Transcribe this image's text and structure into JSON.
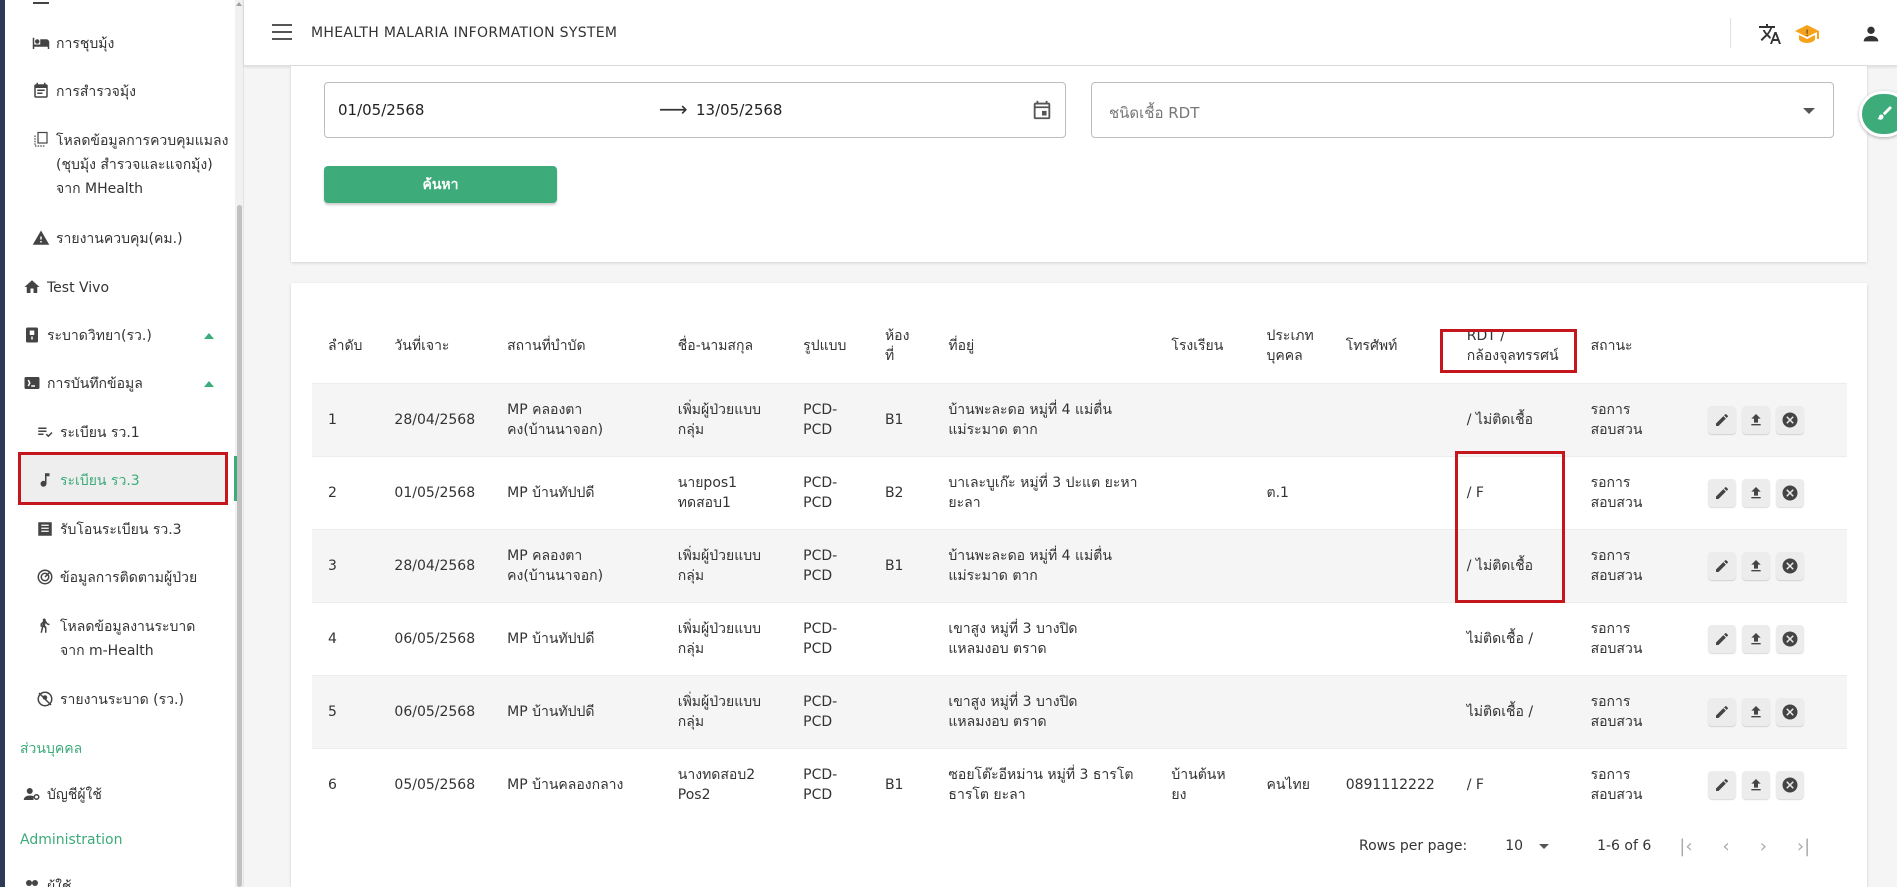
{
  "app": {
    "title": "MHEALTH MALARIA INFORMATION SYSTEM"
  },
  "colors": {
    "accent": "#3dab7a",
    "highlight_border": "#c4161c",
    "sidebar_strip": "#2e3a55"
  },
  "sidebar": {
    "items": [
      {
        "label": "การชุบมุ้ง",
        "icon": "bed-icon"
      },
      {
        "label": "การสำรวจมุ้ง",
        "icon": "event-note-icon"
      },
      {
        "label": "โหลดข้อมูลการควบคุมแมลง (ชุบมุ้ง สำรวจและแจกมุ้ง) จาก MHealth",
        "icon": "library-books-icon"
      },
      {
        "label": "รายงานควบคุม(คม.)",
        "icon": "warning-icon"
      },
      {
        "label": "Test Vivo",
        "icon": "home-icon"
      },
      {
        "label": "ระบาดวิทยา(รว.)",
        "icon": "ballot-icon"
      },
      {
        "label": "การบันทึกข้อมูล",
        "icon": "video-label-icon"
      },
      {
        "label": "ระเบียน รว.1",
        "icon": "playlist-edit-icon"
      },
      {
        "label": "ระเบียน รว.3",
        "icon": "music-note-icon"
      },
      {
        "label": "รับโอนระเบียน รว.3",
        "icon": "list-alt-icon"
      },
      {
        "label": "ข้อมูลการติดตามผู้ป่วย",
        "icon": "track-changes-icon"
      },
      {
        "label": "โหลดข้อมูลงานระบาดจาก m-Health",
        "icon": "person-walking-icon"
      },
      {
        "label": "รายงานระบาด (รว.)",
        "icon": "no-accounts-icon"
      },
      {
        "label": "บัญชีผู้ใช้",
        "icon": "user-cog-icon"
      },
      {
        "label": "ผู้ใช้",
        "icon": "people-icon"
      }
    ],
    "sections": {
      "personal": "ส่วนบุคคล",
      "admin": "Administration"
    }
  },
  "filter": {
    "date_from": "01/05/2568",
    "date_to": "13/05/2568",
    "rdt_placeholder": "ชนิดเชื้อ RDT",
    "search_label": "ค้นหา"
  },
  "table": {
    "headers": {
      "no": "ลำดับ",
      "date": "วันที่เจาะ",
      "place": "สถานที่บำบัด",
      "name": "ชื่อ-นามสกุล",
      "form": "รูปแบบ",
      "room_1": "ห้อง",
      "room_2": "ที่",
      "address": "ที่อยู่",
      "school": "โรงเรียน",
      "ptype_1": "ประเภท",
      "ptype_2": "บุคคล",
      "phone": "โทรศัพท์",
      "rdt_1": "RDT /",
      "rdt_2": "กล้องจุลทรรศน์",
      "status": "สถานะ"
    },
    "rows": [
      {
        "no": "1",
        "date": "28/04/2568",
        "place": "MP คลองตาคง(บ้านนาจอก)",
        "name": "เพิ่มผู้ป่วยแบบกลุ่ม",
        "form": "PCD-PCD",
        "room": "B1",
        "address": "บ้านพะละดอ หมู่ที่ 4 แม่ตื่น แม่ระมาด ตาก",
        "school": "",
        "ptype": "",
        "phone": "",
        "rdt": "/ ไม่ติดเชื้อ",
        "status": "รอการสอบสวน"
      },
      {
        "no": "2",
        "date": "01/05/2568",
        "place": "MP บ้านทัปปดี",
        "name": "นายpos1 ทดสอบ1",
        "form": "PCD-PCD",
        "room": "B2",
        "address": "บาเละบูเก๊ะ หมู่ที่ 3 ปะแต ยะหา ยะลา",
        "school": "",
        "ptype": "ต.1",
        "phone": "",
        "rdt": "/ F",
        "status": "รอการสอบสวน"
      },
      {
        "no": "3",
        "date": "28/04/2568",
        "place": "MP คลองตาคง(บ้านนาจอก)",
        "name": "เพิ่มผู้ป่วยแบบกลุ่ม",
        "form": "PCD-PCD",
        "room": "B1",
        "address": "บ้านพะละดอ หมู่ที่ 4 แม่ตื่น แม่ระมาด ตาก",
        "school": "",
        "ptype": "",
        "phone": "",
        "rdt": "/ ไม่ติดเชื้อ",
        "status": "รอการสอบสวน"
      },
      {
        "no": "4",
        "date": "06/05/2568",
        "place": "MP บ้านทัปปดี",
        "name": "เพิ่มผู้ป่วยแบบกลุ่ม",
        "form": "PCD-PCD",
        "room": "",
        "address": "เขาสูง หมู่ที่ 3 บางปิด แหลมงอบ ตราด",
        "school": "",
        "ptype": "",
        "phone": "",
        "rdt": "ไม่ติดเชื้อ /",
        "status": "รอการสอบสวน"
      },
      {
        "no": "5",
        "date": "06/05/2568",
        "place": "MP บ้านทัปปดี",
        "name": "เพิ่มผู้ป่วยแบบกลุ่ม",
        "form": "PCD-PCD",
        "room": "",
        "address": "เขาสูง หมู่ที่ 3 บางปิด แหลมงอบ ตราด",
        "school": "",
        "ptype": "",
        "phone": "",
        "rdt": "ไม่ติดเชื้อ /",
        "status": "รอการสอบสวน"
      },
      {
        "no": "6",
        "date": "05/05/2568",
        "place": "MP บ้านคลองกลาง",
        "name": "นางทดสอบ2 Pos2",
        "form": "PCD-PCD",
        "room": "B1",
        "address": "ซอยโต๊ะอีหม่าน หมู่ที่ 3 ธารโต ธารโต ยะลา",
        "school": "บ้านต้นหยง",
        "ptype": "คนไทย",
        "phone": "0891112222",
        "rdt": "/ F",
        "status": "รอการสอบสวน"
      }
    ]
  },
  "pagination": {
    "rows_per_page_label": "Rows per page:",
    "rows_per_page": "10",
    "range": "1-6 of 6"
  }
}
